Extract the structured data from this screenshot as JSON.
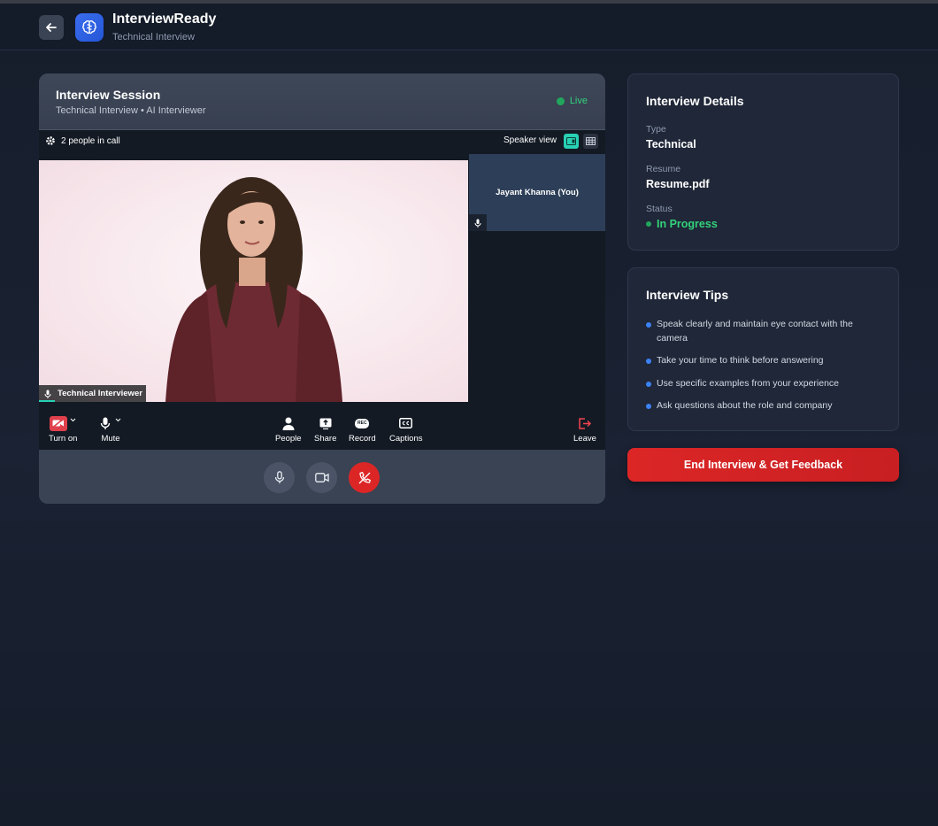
{
  "header": {
    "app_title": "InterviewReady",
    "app_subtitle": "Technical Interview"
  },
  "session": {
    "title": "Interview Session",
    "subtitle": "Technical Interview • AI Interviewer",
    "live_label": "Live"
  },
  "meeting": {
    "people_count": "2 people in call",
    "view_label": "Speaker view",
    "main_participant": "Technical Interviewer",
    "self_participant": "Jayant Khanna (You)",
    "controls": {
      "camera": "Turn on",
      "mute": "Mute",
      "people": "People",
      "share": "Share",
      "record": "Record",
      "captions": "Captions",
      "leave": "Leave"
    },
    "record_badge": "REC"
  },
  "details": {
    "title": "Interview Details",
    "type_label": "Type",
    "type_value": "Technical",
    "resume_label": "Resume",
    "resume_value": "Resume.pdf",
    "status_label": "Status",
    "status_value": "In Progress"
  },
  "tips": {
    "title": "Interview Tips",
    "items": [
      "Speak clearly and maintain eye contact with the camera",
      "Take your time to think before answering",
      "Use specific examples from your experience",
      "Ask questions about the role and company"
    ]
  },
  "end_button": "End Interview & Get Feedback",
  "colors": {
    "accent_blue": "#3b6cf0",
    "live_green": "#34d17b",
    "danger_red": "#dc2626",
    "meet_teal": "#28d1b4"
  }
}
